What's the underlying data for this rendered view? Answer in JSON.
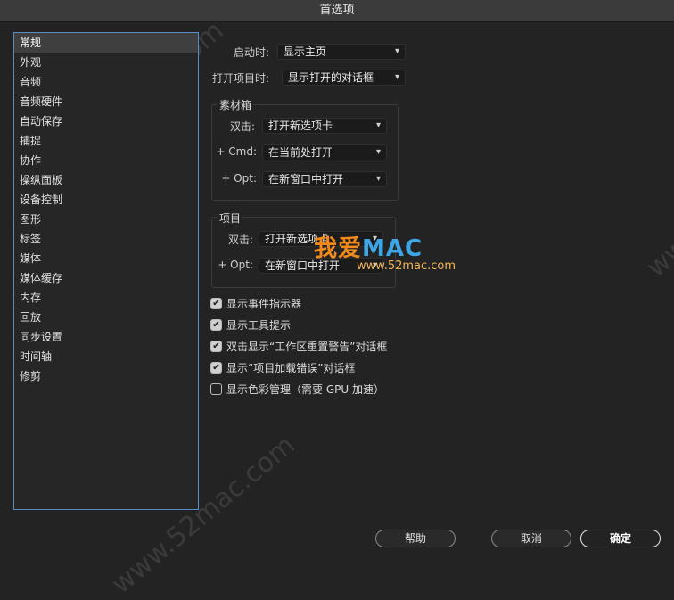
{
  "window": {
    "title": "首选项"
  },
  "sidebar": {
    "items": [
      {
        "label": "常规",
        "selected": true
      },
      {
        "label": "外观"
      },
      {
        "label": "音频"
      },
      {
        "label": "音频硬件"
      },
      {
        "label": "自动保存"
      },
      {
        "label": "捕捉"
      },
      {
        "label": "协作"
      },
      {
        "label": "操纵面板"
      },
      {
        "label": "设备控制"
      },
      {
        "label": "图形"
      },
      {
        "label": "标签"
      },
      {
        "label": "媒体"
      },
      {
        "label": "媒体缓存"
      },
      {
        "label": "内存"
      },
      {
        "label": "回放"
      },
      {
        "label": "同步设置"
      },
      {
        "label": "时间轴"
      },
      {
        "label": "修剪"
      }
    ]
  },
  "general": {
    "startup_label": "启动时:",
    "startup_value": "显示主页",
    "open_project_label": "打开项目时:",
    "open_project_value": "显示打开的对话框"
  },
  "bins": {
    "title": "素材箱",
    "double_click_label": "双击:",
    "double_click_value": "打开新选项卡",
    "cmd_label": "+ Cmd:",
    "cmd_value": "在当前处打开",
    "opt_label": "+ Opt:",
    "opt_value": "在新窗口中打开"
  },
  "project": {
    "title": "项目",
    "double_click_label": "双击:",
    "double_click_value": "打开新选项卡",
    "opt_label": "+ Opt:",
    "opt_value": "在新窗口中打开"
  },
  "checkboxes": [
    {
      "label": "显示事件指示器",
      "checked": true
    },
    {
      "label": "显示工具提示",
      "checked": true
    },
    {
      "label": "双击显示“工作区重置警告”对话框",
      "checked": true
    },
    {
      "label": "显示“项目加载错误”对话框",
      "checked": true
    },
    {
      "label": "显示色彩管理（需要 GPU 加速）",
      "checked": false
    }
  ],
  "footer": {
    "help_label": "帮助",
    "cancel_label": "取消",
    "ok_label": "确定"
  },
  "watermark": {
    "text": "www.52mac.com",
    "logo_cn": "我爱",
    "logo_en": "MAC",
    "logo_url": "www.52mac.com"
  },
  "icons": {
    "dropdown": "chevron-down-icon",
    "check": "checkmark-icon"
  },
  "colors": {
    "background": "#232323",
    "selection_border": "#5b89c9",
    "logo_orange": "#f08a1c",
    "logo_blue": "#3ea6e6"
  }
}
